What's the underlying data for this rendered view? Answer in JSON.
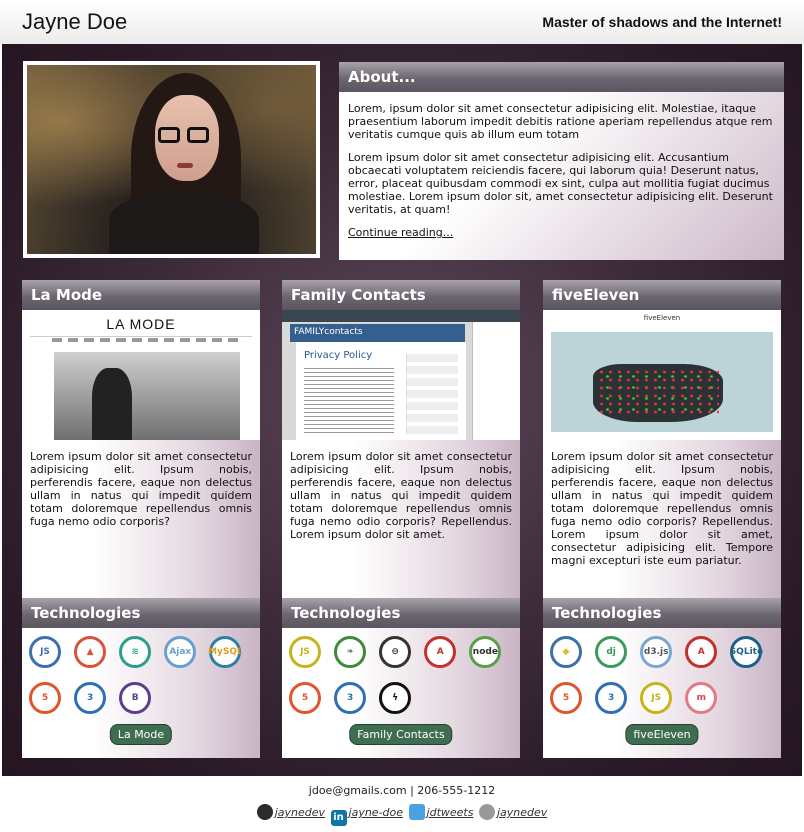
{
  "header": {
    "site_title": "Jayne Doe",
    "tagline": "Master of shadows and the Internet!"
  },
  "about": {
    "title": "About...",
    "paragraph1": "Lorem, ipsum dolor sit amet consectetur adipisicing elit. Molestiae, itaque praesentium laborum impedit debitis ratione aperiam repellendus atque rem veritatis cumque quis ab illum eum totam",
    "paragraph2": "Lorem ipsum dolor sit amet consectetur adipisicing elit. Accusantium obcaecati voluptatem reiciendis facere, qui laborum quia! Deserunt natus, error, placeat quibusdam commodi ex sint, culpa aut mollitia fugiat ducimus molestiae. Lorem ipsum dolor sit, amet consectetur adipisicing elit. Deserunt veritatis, at quam!",
    "link": "Continue reading..."
  },
  "projects": [
    {
      "title": "La Mode",
      "screenshot_text": "LA MODE",
      "description": "Lorem ipsum dolor sit amet consectetur adipisicing elit. Ipsum nobis, perferendis facere, eaque non delectus ullam in natus qui impedit quidem totam doloremque repellendus omnis fuga nemo odio corporis?",
      "tech_title": "Technologies",
      "technologies": [
        "JS",
        "code-icon",
        "css-icon",
        "Ajax",
        "MySQL",
        "HTML5",
        "CSS3",
        "B"
      ],
      "button": "La Mode"
    },
    {
      "title": "Family Contacts",
      "screenshot_header": "FAMILYcontacts",
      "screenshot_text": "Privacy Policy",
      "description": "Lorem ipsum dolor sit amet consectetur adipisicing elit. Ipsum nobis, perferendis facere, eaque non delectus ullam in natus qui impedit quidem totam doloremque repellendus omnis fuga nemo odio corporis? Repellendus. Lorem ipsum dolor sit amet.",
      "tech_title": "Technologies",
      "technologies": [
        "JS",
        "mongo",
        "express",
        "A",
        "node",
        "HTML5",
        "CSS3",
        "flash"
      ],
      "button": "Family Contacts"
    },
    {
      "title": "fiveEleven",
      "screenshot_text": "fiveEleven",
      "description": "Lorem ipsum dolor sit amet consectetur adipisicing elit. Ipsum nobis, perferendis facere, eaque non delectus ullam in natus qui impedit quidem totam doloremque repellendus omnis fuga nemo odio corporis? Repellendus. Lorem ipsum dolor sit amet, consectetur adipisicing elit. Tempore magni excepturi iste eum pariatur.",
      "tech_title": "Technologies",
      "technologies": [
        "python",
        "dj",
        "d3.js",
        "A",
        "SQLite",
        "HTML5",
        "CSS3",
        "JS",
        "m"
      ],
      "button": "fiveEleven"
    }
  ],
  "footer": {
    "contact": "jdoe@gmails.com | 206-555-1212",
    "social": [
      {
        "icon": "github-icon",
        "label": "jaynedev"
      },
      {
        "icon": "linkedin-icon",
        "label": "jayne-doe"
      },
      {
        "icon": "twitter-icon",
        "label": "jdtweets"
      },
      {
        "icon": "codepen-icon",
        "label": "jaynedev"
      }
    ]
  },
  "colors": {
    "accent_green": "#3f6d50",
    "panel_header": "#6c6670",
    "background_dark": "#2a1a27"
  }
}
